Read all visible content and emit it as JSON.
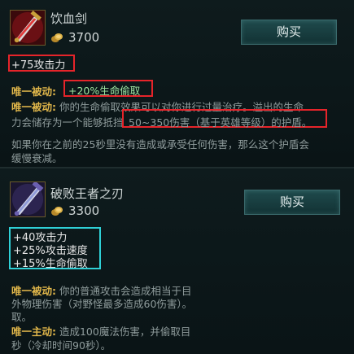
{
  "item1": {
    "name": "饮血剑",
    "price": "3700",
    "buy_label": "购买",
    "stat": "+75攻击力",
    "passive1_label": "唯一被动:",
    "passive1_value": "+20%生命偷取",
    "passive2_label": "唯一被动:",
    "passive2_line1": "你的生命偷取效果可以对你进行过量治疗。溢出的生命",
    "passive2_line2a": "力会储存为一个能够抵挡",
    "passive2_line2b": "50~350伤害（基于英雄等级）的护盾。",
    "extra_line1": "如果你在之前的25秒里没有造成或承受任何伤害，那么这个护盾会",
    "extra_line2": "缓慢衰减。"
  },
  "item2": {
    "name": "破败王者之刃",
    "price": "3300",
    "buy_label": "购买",
    "stats": [
      "+40攻击力",
      "+25%攻击速度",
      "+15%生命偷取"
    ],
    "passive_label": "唯一被动:",
    "passive_line1": "你的普通攻击会造成相当于目",
    "passive_line2": "外物理伤害（对野怪最多造成60伤害）。",
    "passive_line3": "取。",
    "active_label": "唯一主动:",
    "active_line1": "造成100魔法伤害，并偷取目",
    "active_line2": "秒（冷却时间90秒）。"
  },
  "colors": {
    "highlight_red": "#e6242a",
    "highlight_cyan": "#2fd0d6",
    "gold_label": "#e0b64a"
  },
  "icons": {
    "item1": "bloodthirster-sword-icon",
    "item2": "blade-of-ruined-king-icon",
    "gold": "gold-coin-icon"
  }
}
